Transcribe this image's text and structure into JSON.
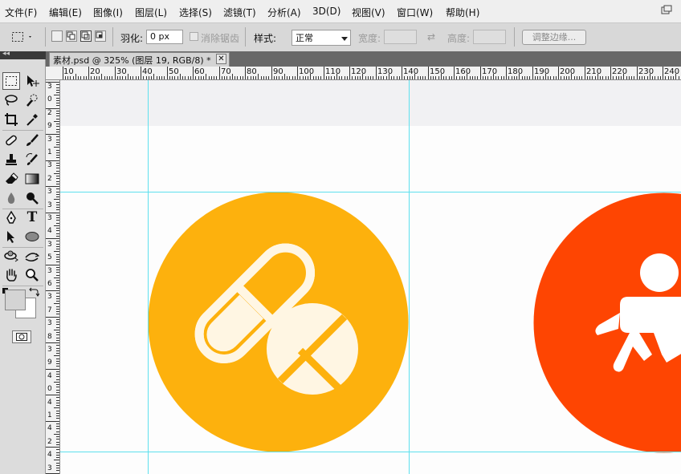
{
  "menu": {
    "items": [
      "文件(F)",
      "编辑(E)",
      "图像(I)",
      "图层(L)",
      "选择(S)",
      "滤镜(T)",
      "分析(A)",
      "3D(D)",
      "视图(V)",
      "窗口(W)",
      "帮助(H)"
    ]
  },
  "options": {
    "feather_label": "羽化:",
    "feather_value": "0 px",
    "antialias_label": "消除锯齿",
    "style_label": "样式:",
    "style_value": "正常",
    "width_label": "宽度:",
    "height_label": "高度:",
    "refine_edge_label": "调整边缘..."
  },
  "document": {
    "tab_title": "素材.psd @ 325% (图层 19, RGB/8) *",
    "close_glyph": "✕"
  },
  "ruler": {
    "h_labels": [
      "10",
      "20",
      "30",
      "40",
      "50",
      "60",
      "70",
      "80",
      "90",
      "100",
      "110",
      "120",
      "130",
      "140",
      "150",
      "160",
      "170",
      "180",
      "190",
      "200",
      "210",
      "220",
      "230",
      "240"
    ],
    "v_labels": [
      "3",
      "0",
      "2",
      "9",
      "3",
      "1",
      "3",
      "2",
      "3",
      "3",
      "3",
      "4",
      "3",
      "5",
      "3",
      "6",
      "3",
      "7",
      "3",
      "8",
      "3",
      "9",
      "4",
      "0",
      "4",
      "1",
      "4",
      "2",
      "4",
      "3"
    ]
  },
  "colors": {
    "pill_icon_bg": "#FDB10D",
    "baby_icon_bg": "#FE4502",
    "guide": "#5EE0EE",
    "canvas_band": "#F1F1F3"
  },
  "icons": {
    "left_icon": "pill-icon",
    "right_icon": "baby-icon"
  }
}
